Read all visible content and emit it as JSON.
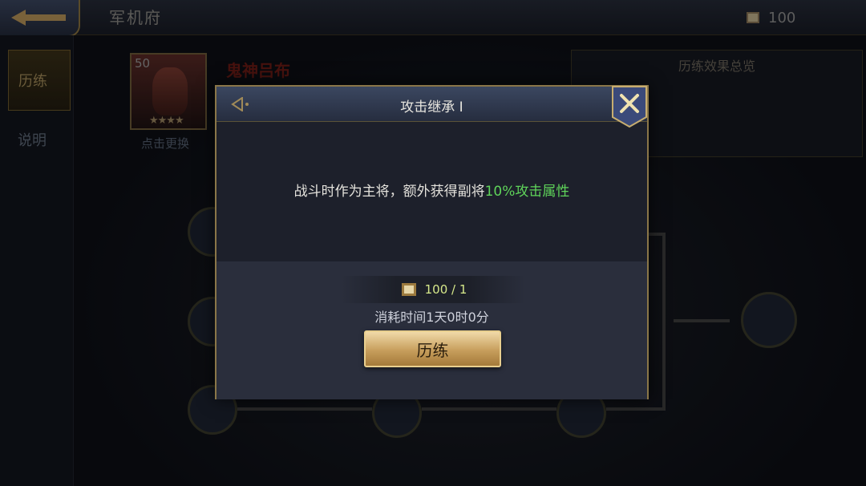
{
  "header": {
    "title": "军机府",
    "currency_value": "100",
    "currency_icon": "scroll-icon"
  },
  "sidebar": {
    "items": [
      {
        "label": "历练",
        "active": true
      },
      {
        "label": "说明",
        "active": false
      }
    ]
  },
  "hero": {
    "level": "50",
    "name": "鬼神吕布",
    "stars": "★★★★",
    "swap_label": "点击更换"
  },
  "summary": {
    "title": "历练效果总览"
  },
  "dialog": {
    "title": "攻击继承 I",
    "description_prefix": "战斗时作为主将，额外获得副将",
    "description_highlight": "10%攻击属性",
    "cost": "100 / 1",
    "time": "消耗时间1天0时0分",
    "train_button": "历练",
    "highlight_color": "#5fd45a"
  }
}
